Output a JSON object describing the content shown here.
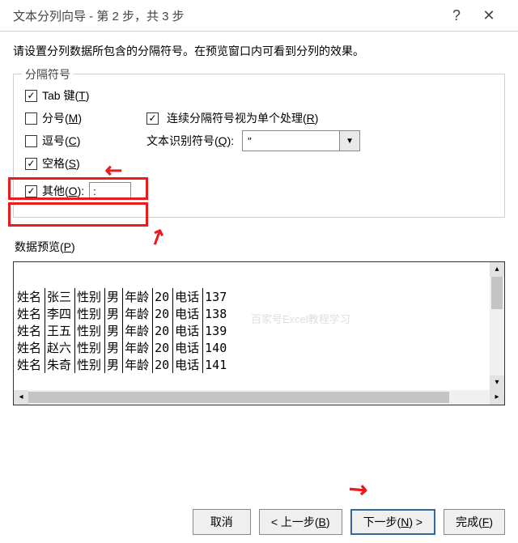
{
  "title": "文本分列向导 - 第 2 步，共 3 步",
  "instruction": "请设置分列数据所包含的分隔符号。在预览窗口内可看到分列的效果。",
  "group": {
    "legend": "分隔符号",
    "tab": {
      "label_pre": "Tab 键(",
      "u": "T",
      "label_post": ")",
      "checked": true
    },
    "semi": {
      "label_pre": "分号(",
      "u": "M",
      "label_post": ")",
      "checked": false
    },
    "comma": {
      "label_pre": "逗号(",
      "u": "C",
      "label_post": ")",
      "checked": false
    },
    "space": {
      "label_pre": "空格(",
      "u": "S",
      "label_post": ")",
      "checked": true
    },
    "other": {
      "label_pre": "其他(",
      "u": "O",
      "label_post": "):",
      "checked": true,
      "value": ": "
    },
    "consec": {
      "label_pre": "连续分隔符号视为单个处理(",
      "u": "R",
      "label_post": ")",
      "checked": true
    },
    "textq": {
      "label_pre": "文本识别符号(",
      "u": "Q",
      "label_post": "):",
      "value": "\""
    }
  },
  "preview": {
    "label_pre": "数据预览(",
    "u": "P",
    "label_post": ")",
    "headers": [
      "姓名",
      "",
      "性别",
      "",
      "年龄",
      "",
      "电话",
      ""
    ],
    "rows": [
      [
        "姓名",
        "张三",
        "性别",
        "男",
        "年龄",
        "20",
        "电话",
        "137"
      ],
      [
        "姓名",
        "李四",
        "性别",
        "男",
        "年龄",
        "20",
        "电话",
        "138"
      ],
      [
        "姓名",
        "王五",
        "性别",
        "男",
        "年龄",
        "20",
        "电话",
        "139"
      ],
      [
        "姓名",
        "赵六",
        "性别",
        "男",
        "年龄",
        "20",
        "电话",
        "140"
      ],
      [
        "姓名",
        "朱奇",
        "性别",
        "男",
        "年龄",
        "20",
        "电话",
        "141"
      ]
    ]
  },
  "buttons": {
    "cancel": "取消",
    "back_pre": "< 上一步(",
    "back_u": "B",
    "back_post": ")",
    "next_pre": "下一步(",
    "next_u": "N",
    "next_post": ") >",
    "finish_pre": "完成(",
    "finish_u": "F",
    "finish_post": ")"
  },
  "watermark": "百家号Excel教程学习"
}
